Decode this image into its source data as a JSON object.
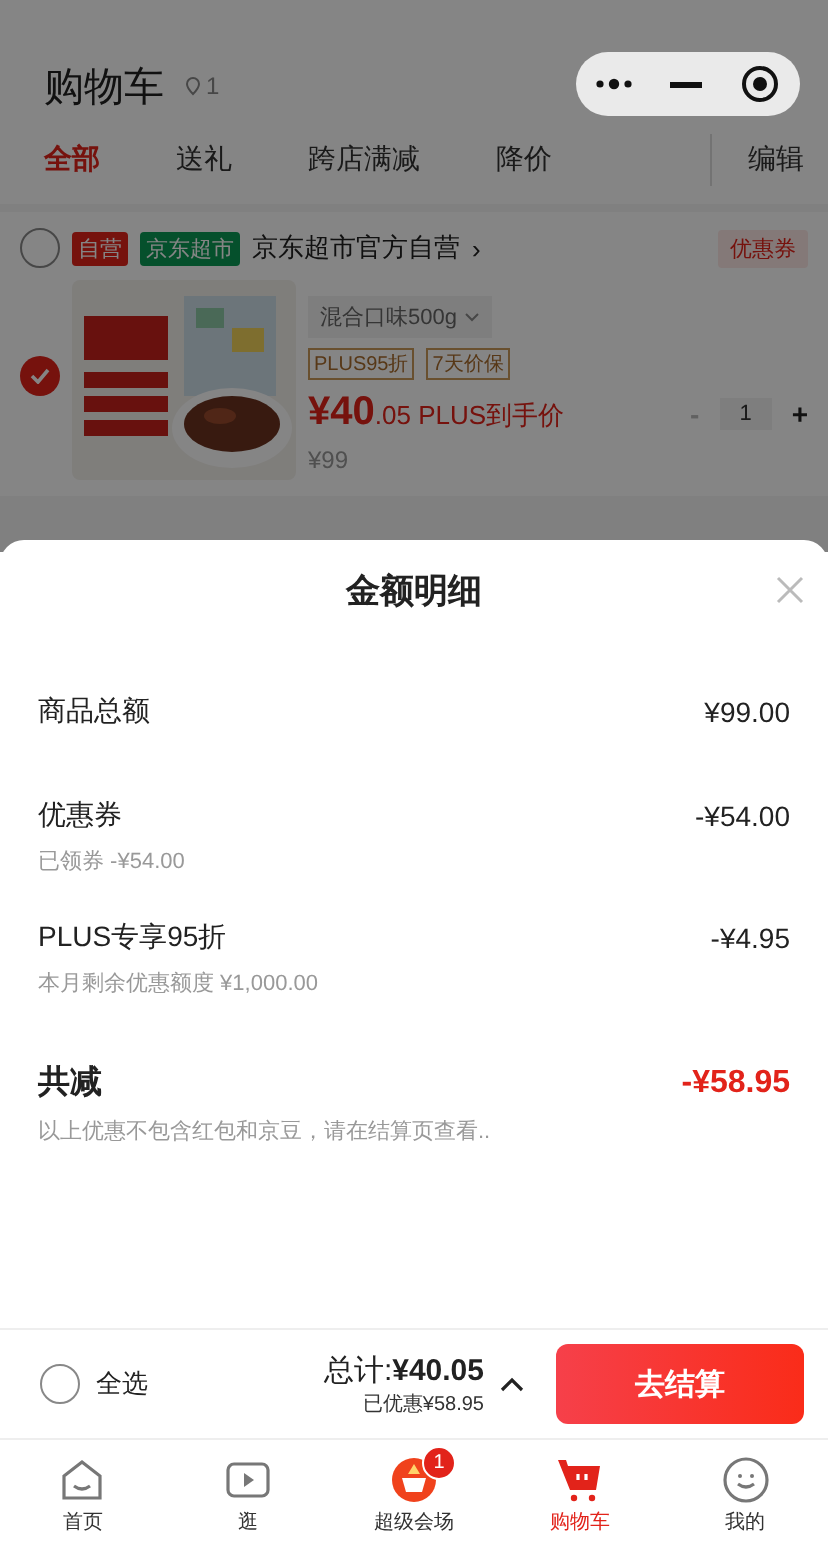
{
  "header": {
    "title": "购物车",
    "location_count": "1"
  },
  "tabs": [
    {
      "label": "全部",
      "selected": true
    },
    {
      "label": "送礼",
      "selected": false
    },
    {
      "label": "跨店满减",
      "selected": false
    },
    {
      "label": "降价",
      "selected": false
    }
  ],
  "edit": "编辑",
  "shop": {
    "checked": false,
    "badges": [
      {
        "label": "自营",
        "kind": "self"
      },
      {
        "label": "京东超市",
        "kind": "market"
      }
    ],
    "name": "京东超市官方自营",
    "arrow": "›",
    "coupon": "优惠券"
  },
  "product": {
    "checked": true,
    "variant": "混合口味500g",
    "tags": [
      "PLUS95折",
      "7天价保"
    ],
    "price_int": "¥40",
    "price_dec": ".05",
    "price_note": "PLUS到手价",
    "original_price": "¥99",
    "minus": "-",
    "quantity": "1",
    "plus": "+"
  },
  "sheet": {
    "title": "金额明细",
    "lines": [
      {
        "label": "商品总额",
        "amount": "¥99.00"
      },
      {
        "label": "优惠券",
        "amount": "-¥54.00",
        "note": "已领券 -¥54.00"
      },
      {
        "label": "PLUS专享95折",
        "amount": "-¥4.95",
        "note": "本月剩余优惠额度 ¥1,000.00"
      }
    ],
    "total": {
      "label": "共减",
      "amount": "-¥58.95"
    },
    "footnote": "以上优惠不包含红包和京豆，请在结算页查看.."
  },
  "checkout": {
    "select_all_checked": false,
    "select_all": "全选",
    "total_label": "总计:",
    "total": "¥40.05",
    "saved": "已优惠¥58.95",
    "button": "去结算"
  },
  "tabbar": [
    {
      "kind": "home",
      "label": "首页",
      "selected": false
    },
    {
      "kind": "video",
      "label": "逛",
      "selected": false
    },
    {
      "kind": "venue",
      "label": "超级会场",
      "selected": false,
      "badge": "1"
    },
    {
      "kind": "cart",
      "label": "购物车",
      "selected": true
    },
    {
      "kind": "me",
      "label": "我的",
      "selected": false
    }
  ]
}
